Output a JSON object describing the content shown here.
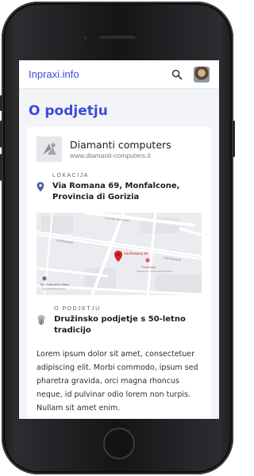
{
  "header": {
    "brand": "Inpraxi.info"
  },
  "page": {
    "title": "O podjetju"
  },
  "company": {
    "name": "Diamanti computers",
    "website": "www.diamanti-computers.it"
  },
  "location": {
    "label": "LOKACIJA",
    "address": "Via Romana 69, Monfalcone, Provincia di Gorizia"
  },
  "map": {
    "pin_label": "Via Romana, 69",
    "poi_pharmacy": "Pharmacy",
    "poi_pharmacy_sub": "Farmacia S. Nicolò Dalla Moldava",
    "poi_tax": "Tax Collector's Office",
    "poi_tax_sub": "Agenzia delle Entrate",
    "street_via_romana": "Via Romana",
    "street_other": "Piazzale delle Rose"
  },
  "about": {
    "label": "O PODJETJU",
    "title": "Družinsko podjetje s 50-letno tradicijo"
  },
  "description": "Lorem ipsum dolor sit amet, consectetuer adipiscing elit. Morbi commodo, ipsum sed pharetra gravida, orci magna rhoncus neque, id pulvinar odio lorem non turpis. Nullam sit amet enim.",
  "colors": {
    "accent": "#3a4bd8",
    "pin": "#d82128",
    "screen_bg": "#f3f4f8"
  }
}
